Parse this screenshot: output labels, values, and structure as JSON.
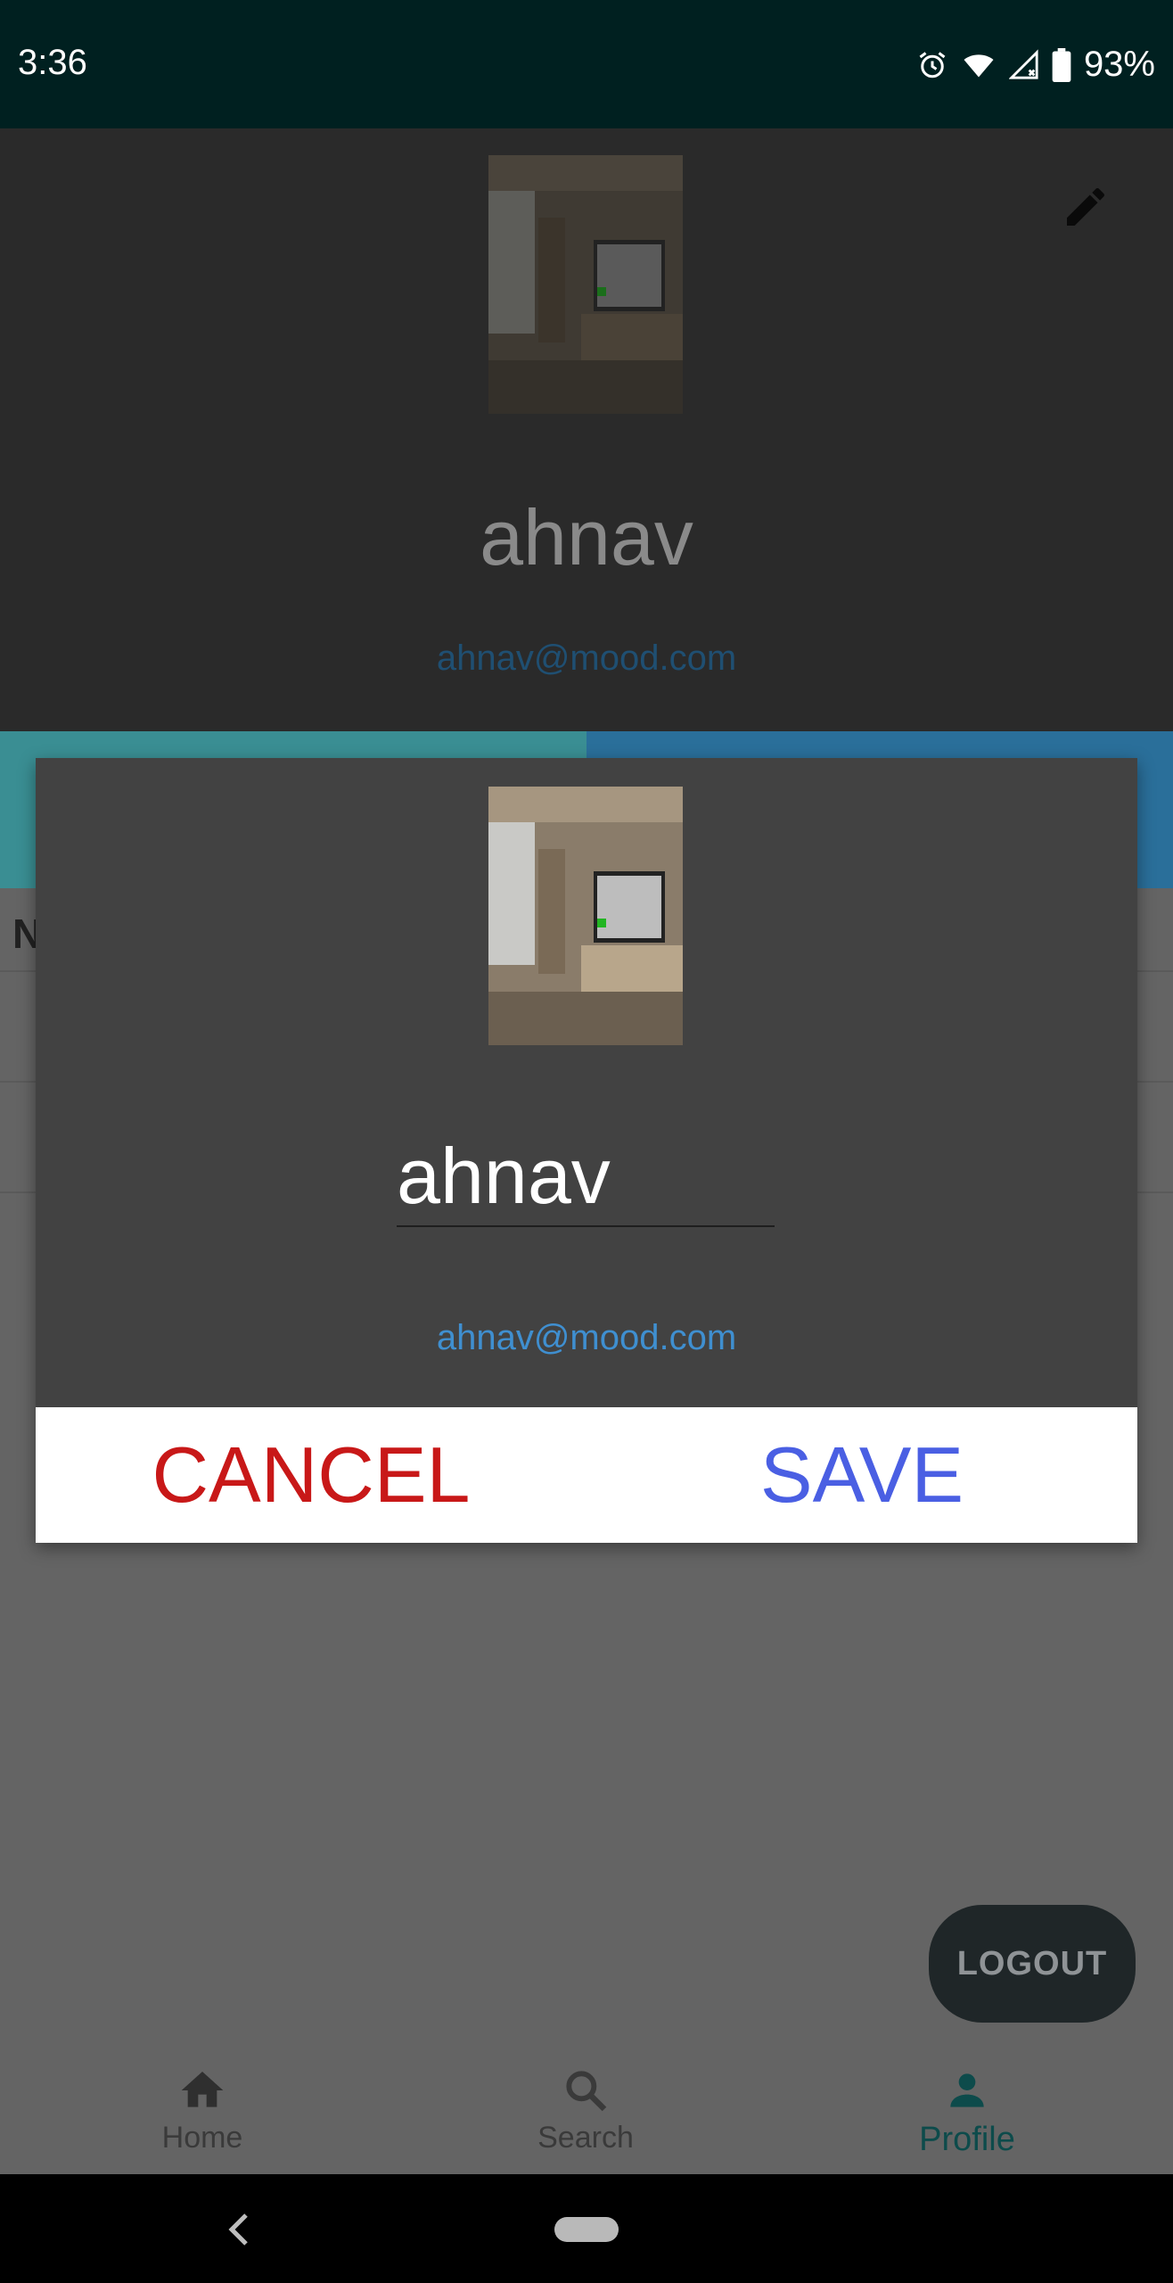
{
  "status_bar": {
    "time": "3:36",
    "battery_percent": "93%",
    "icons": [
      "alarm-icon",
      "wifi-icon",
      "signal-icon",
      "battery-icon"
    ]
  },
  "profile": {
    "name": "ahnav",
    "email": "ahnav@mood.com",
    "section_letter": "N"
  },
  "dialog": {
    "name_value": "ahnav",
    "email": "ahnav@mood.com",
    "cancel_label": "CANCEL",
    "save_label": "SAVE"
  },
  "logout_label": "LOGOUT",
  "nav": {
    "items": [
      {
        "label": "Home",
        "icon": "home-icon"
      },
      {
        "label": "Search",
        "icon": "search-icon"
      },
      {
        "label": "Profile",
        "icon": "person-icon",
        "active": true
      }
    ]
  },
  "colors": {
    "status_bar": "#002020",
    "cancel": "#c81818",
    "save": "#4a5fe3",
    "email": "#3f8fd0",
    "active_nav": "#0d4b4b"
  }
}
